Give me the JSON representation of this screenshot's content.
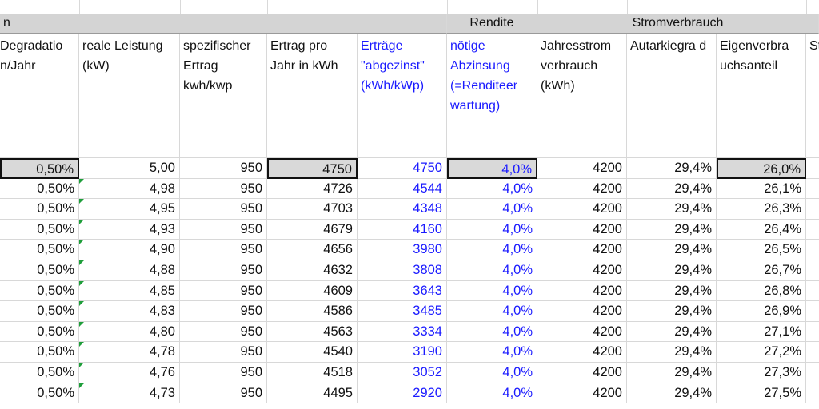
{
  "groups": {
    "left": "n",
    "rendite": "Rendite",
    "strom": "Stromverbrauch"
  },
  "headers": {
    "degradation": "Degradatio n/Jahr",
    "reale_leistung": "reale Leistung (kW)",
    "spez_ertrag": "spezifischer Ertrag kwh/kwp",
    "ertrag_jahr": "Ertrag pro Jahr in kWh",
    "ertraege_abgezinst": "Erträge \"abgezinst\" (kWh/kWp)",
    "abzinsung": "nötige Abzinsung (=Renditeer wartung)",
    "jahresstrom": "Jahresstrom verbrauch (kWh)",
    "autarkie": "Autarkiegra d",
    "eigenverbrauch": "Eigenverbra uchsanteil",
    "next": "St is"
  },
  "rows": [
    [
      "0,50%",
      "5,00",
      "950",
      "4750",
      "4750",
      "4,0%",
      "4200",
      "29,4%",
      "26,0%"
    ],
    [
      "0,50%",
      "4,98",
      "950",
      "4726",
      "4544",
      "4,0%",
      "4200",
      "29,4%",
      "26,1%"
    ],
    [
      "0,50%",
      "4,95",
      "950",
      "4703",
      "4348",
      "4,0%",
      "4200",
      "29,4%",
      "26,3%"
    ],
    [
      "0,50%",
      "4,93",
      "950",
      "4679",
      "4160",
      "4,0%",
      "4200",
      "29,4%",
      "26,4%"
    ],
    [
      "0,50%",
      "4,90",
      "950",
      "4656",
      "3980",
      "4,0%",
      "4200",
      "29,4%",
      "26,5%"
    ],
    [
      "0,50%",
      "4,88",
      "950",
      "4632",
      "3808",
      "4,0%",
      "4200",
      "29,4%",
      "26,7%"
    ],
    [
      "0,50%",
      "4,85",
      "950",
      "4609",
      "3643",
      "4,0%",
      "4200",
      "29,4%",
      "26,8%"
    ],
    [
      "0,50%",
      "4,83",
      "950",
      "4586",
      "3485",
      "4,0%",
      "4200",
      "29,4%",
      "26,9%"
    ],
    [
      "0,50%",
      "4,80",
      "950",
      "4563",
      "3334",
      "4,0%",
      "4200",
      "29,4%",
      "27,1%"
    ],
    [
      "0,50%",
      "4,78",
      "950",
      "4540",
      "3190",
      "4,0%",
      "4200",
      "29,4%",
      "27,2%"
    ],
    [
      "0,50%",
      "4,76",
      "950",
      "4518",
      "3052",
      "4,0%",
      "4200",
      "29,4%",
      "27,3%"
    ],
    [
      "0,50%",
      "4,73",
      "950",
      "4495",
      "2920",
      "4,0%",
      "4200",
      "29,4%",
      "27,5%"
    ]
  ],
  "colors": {
    "blue_text": "#1a1aff",
    "header_fill": "#d4d4d4",
    "comment_marker": "#1e9e3a"
  }
}
